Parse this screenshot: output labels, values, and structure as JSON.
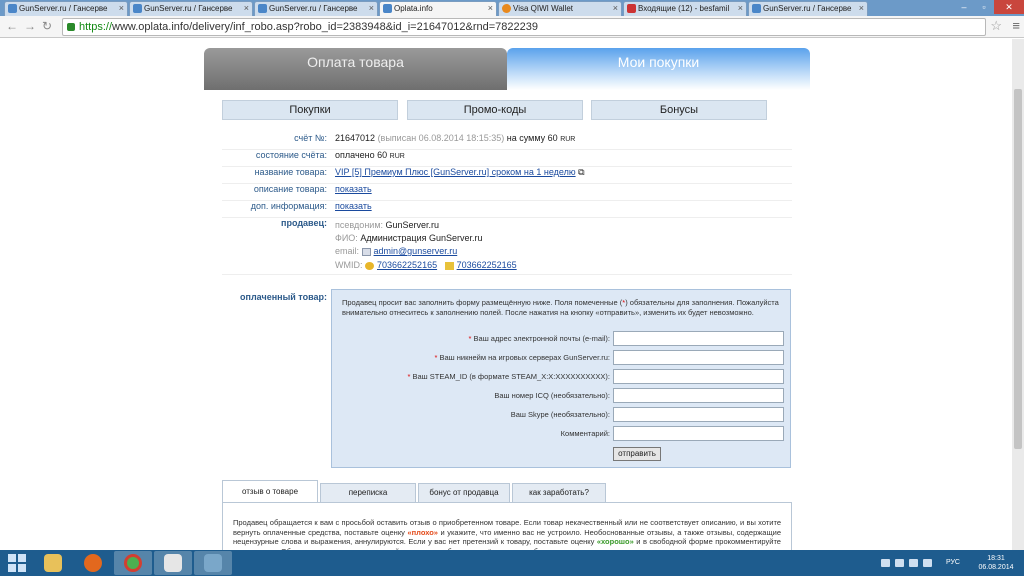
{
  "browser": {
    "tabs": [
      {
        "title": "GunServer.ru / Гансерве",
        "icon": "gunserver-favicon"
      },
      {
        "title": "GunServer.ru / Гансерве",
        "icon": "gunserver-favicon"
      },
      {
        "title": "GunServer.ru / Гансерве",
        "icon": "gunserver-favicon"
      },
      {
        "title": "Oplata.info",
        "icon": "oplata-favicon",
        "active": true
      },
      {
        "title": "Visa QIWI Wallet",
        "icon": "qiwi-favicon"
      },
      {
        "title": "Входящие (12) - besfamil",
        "icon": "gmail-favicon"
      },
      {
        "title": "GunServer.ru / Гансерве",
        "icon": "gunserver-favicon"
      }
    ],
    "url_scheme": "https://",
    "url_rest": "www.oplata.info/delivery/inf_robo.asp?robo_id=2383948&id_i=21647012&rnd=7822239"
  },
  "main_tabs": {
    "payment": "Оплата товара",
    "purchases": "Мои покупки"
  },
  "subnav": {
    "purchases": "Покупки",
    "promo": "Промо-коды",
    "bonuses": "Бонусы"
  },
  "invoice": {
    "label": "счёт №:",
    "number": "21647012",
    "issued": "(выписан 06.08.2014 18:15:35)",
    "sum_prefix": "на сумму",
    "amount": "60",
    "currency": "RUR"
  },
  "status": {
    "label": "состояние счёта:",
    "text": "оплачено 60",
    "currency": "RUR"
  },
  "product": {
    "label": "название товара:",
    "name": "VIP [5] Премиум Плюс [GunServer.ru] сроком на 1 неделю"
  },
  "description": {
    "label": "описание товара:",
    "link": "показать"
  },
  "extra_info": {
    "label": "доп. информация:",
    "link": "показать"
  },
  "seller": {
    "label": "продавец:",
    "alias_label": "псевдоним:",
    "alias": "GunServer.ru",
    "fio_label": "ФИО:",
    "fio": "Администрация GunServer.ru",
    "email_label": "email:",
    "email": "admin@gunserver.ru",
    "wmid_label": "WMID:",
    "wmid1": "703662252165",
    "wmid2": "703662252165"
  },
  "paid_item": {
    "label": "оплаченный товар:",
    "intro_1": "Продавец просит вас заполнить форму размещённую ниже. Поля помеченные (",
    "intro_star": "*",
    "intro_2": ") обязательны для заполнения. Пожалуйста внимательно отнеситесь к заполнению полей. После нажатия на кнопку «отправить», изменить их будет невозможно.",
    "fields": [
      {
        "label": "Ваш адрес электронной почты (e-mail):",
        "required": true
      },
      {
        "label": "Ваш никнейм на игровых серверах GunServer.ru:",
        "required": true
      },
      {
        "label": "Ваш STEAM_ID (в формате STEAM_X:X:XXXXXXXXXX):",
        "required": true
      },
      {
        "label": "Ваш номер ICQ (необязательно):",
        "required": false
      },
      {
        "label": "Ваш Skype (необязательно):",
        "required": false
      },
      {
        "label": "Комментарий:",
        "required": false
      }
    ],
    "required_mark": "*",
    "submit": "отправить"
  },
  "bottom_tabs": [
    "отзыв о товаре",
    "переписка",
    "бонус от продавца",
    "как заработать?"
  ],
  "review": {
    "t1": "Продавец обращается к вам с просьбой оставить отзыв о приобретенном товаре. Если товар некачественный или не соответствует описанию, и вы хотите вернуть оплаченные средства, поставьте оценку ",
    "bad": "«плохо»",
    "t2": " и укажите, что именно вас не устроило. Необоснованные отзывы, а также отзывы, содержащие нецензурные слова и выражения, аннулируются. Если у вас нет претензий к товару, поставьте оценку ",
    "good": "«хорошо»",
    "t3": " и в свободной форме прокомментируйте это в отзыве. Обращаем внимание, что данный отзыв может быть изменён вами в любое время."
  },
  "taskbar": {
    "apps": [
      "explorer-icon",
      "firefox-icon",
      "chrome-icon",
      "counter-strike-icon",
      "sketch-app-icon"
    ],
    "lang": "РУС",
    "time": "18:31",
    "date": "06.08.2014"
  }
}
